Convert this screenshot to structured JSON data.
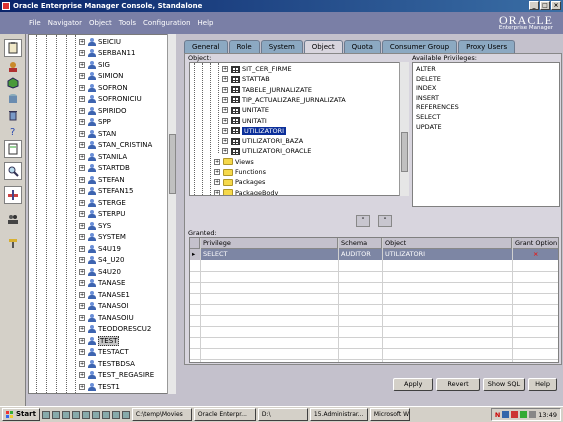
{
  "window": {
    "title": "Oracle Enterprise Manager Console, Standalone",
    "buttons": [
      "_",
      "□",
      "×"
    ]
  },
  "menu": [
    "File",
    "Navigator",
    "Object",
    "Tools",
    "Configuration",
    "Help"
  ],
  "logo": {
    "line1": "ORACLE",
    "line2": "Enterprise Manager"
  },
  "tree": {
    "items": [
      "SEICIU",
      "SERBAN11",
      "SIG",
      "SIMION",
      "SOFRON",
      "SOFRONICIU",
      "SPIRIDO",
      "SPP",
      "STAN",
      "STAN_CRISTINA",
      "STANILA",
      "STARTDB",
      "STEFAN",
      "STEFAN15",
      "STERGE",
      "STERPU",
      "SYS",
      "SYSTEM",
      "S4U19",
      "S4_U20",
      "S4U20",
      "TANASE",
      "TANASE1",
      "TANASOI",
      "TANASOIU",
      "TEODORESCU2",
      "TEST",
      "TESTACT",
      "TESTBDSA",
      "TEST_REGASIRE",
      "TEST1"
    ],
    "selected": "TEST"
  },
  "tabs": [
    "General",
    "Role",
    "System",
    "Object",
    "Quota",
    "Consumer Group",
    "Proxy Users"
  ],
  "active_tab": "Object",
  "object_label": "Object:",
  "objects": [
    {
      "label": "SIT_CER_FIRME",
      "kind": "table"
    },
    {
      "label": "STATTAB",
      "kind": "table"
    },
    {
      "label": "TABELE_JURNALIZATE",
      "kind": "table"
    },
    {
      "label": "TIP_ACTUALIZARE_JURNALIZATA",
      "kind": "table"
    },
    {
      "label": "UNITATE",
      "kind": "table"
    },
    {
      "label": "UNITATI",
      "kind": "table"
    },
    {
      "label": "UTILIZATORI",
      "kind": "table"
    },
    {
      "label": "UTILIZATORI_BAZA",
      "kind": "table"
    },
    {
      "label": "UTILIZATORI_ORACLE",
      "kind": "table"
    },
    {
      "label": "Views",
      "kind": "folder"
    },
    {
      "label": "Functions",
      "kind": "folder"
    },
    {
      "label": "Packages",
      "kind": "folder"
    },
    {
      "label": "PackageBody",
      "kind": "folder"
    }
  ],
  "selected_object": "UTILIZATORI",
  "available_label": "Available Privileges:",
  "privileges": [
    "ALTER",
    "DELETE",
    "INDEX",
    "INSERT",
    "REFERENCES",
    "SELECT",
    "UPDATE"
  ],
  "arrow_down": "˅",
  "arrow_up": "˄",
  "granted_label": "Granted:",
  "grant_columns": [
    "Privilege",
    "Schema",
    "Object",
    "Grant Option"
  ],
  "granted": [
    {
      "privilege": "SELECT",
      "schema": "AUDITOR",
      "object": "UTILIZATORI",
      "grant_option": "×"
    }
  ],
  "buttons": {
    "apply": "Apply",
    "revert": "Revert",
    "show_sql": "Show SQL",
    "help": "Help"
  },
  "taskbar": {
    "start": "Start",
    "tasks": [
      "C:\\temp\\Movies",
      "Oracle Enterpr...",
      "D:\\",
      "15.Administrar...",
      "Microsoft Word..."
    ],
    "tray": {
      "lang": "N",
      "time": "13:49"
    }
  },
  "colors": {
    "title": "#0a246a",
    "menubar": "#7a7fa6",
    "tab": "#8ca9c2",
    "selection": "#0b2f9a",
    "granted_row": "#7d86a4"
  }
}
